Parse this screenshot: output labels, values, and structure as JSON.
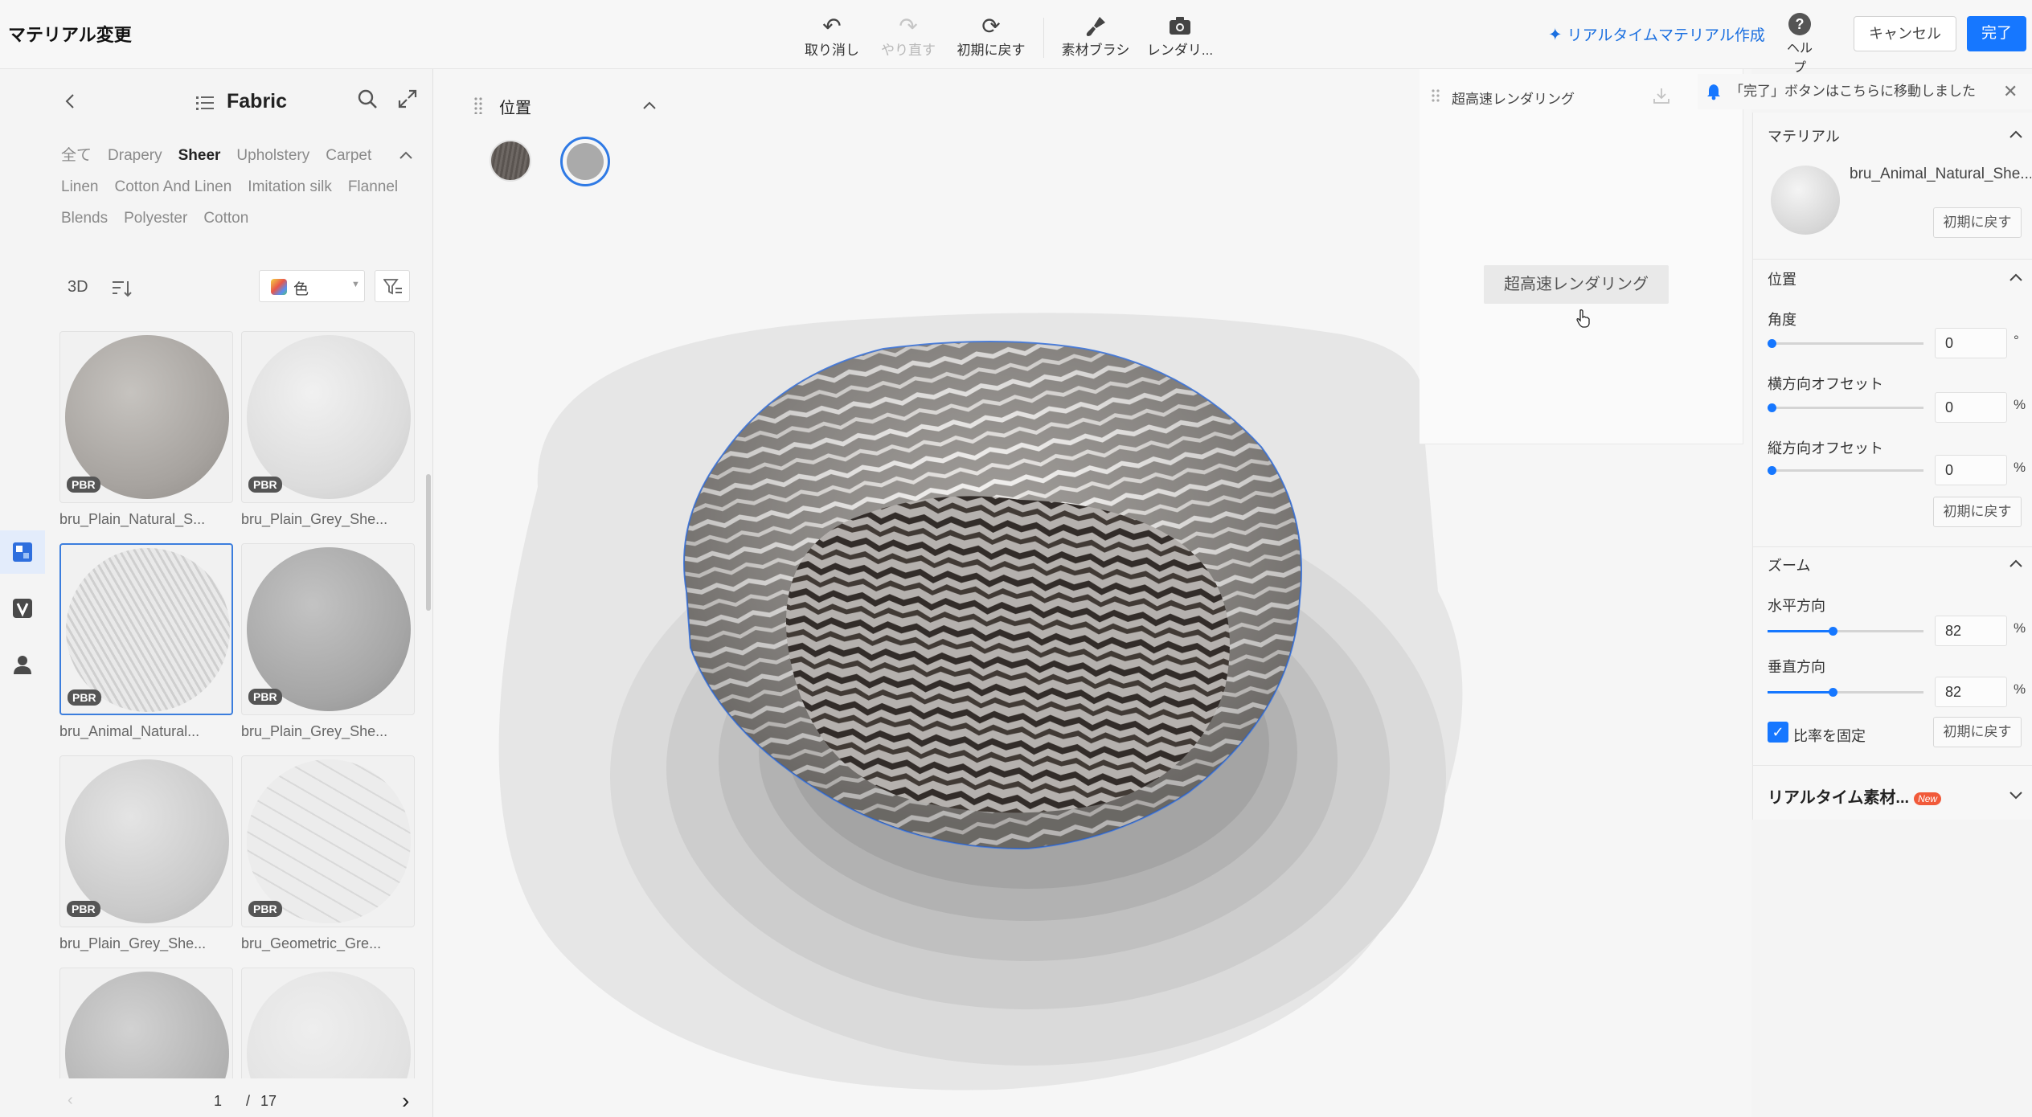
{
  "app": {
    "title": "マテリアル変更"
  },
  "toolbar": {
    "undo": "取り消し",
    "redo": "やり直す",
    "reset": "初期に戻す",
    "brush": "素材ブラシ",
    "render": "レンダリ..."
  },
  "header": {
    "realtime_link": "リアルタイムマテリアル作成",
    "help": "ヘルプ",
    "cancel": "キャンセル",
    "done": "完了",
    "accent": "#1677ff"
  },
  "library": {
    "title": "Fabric",
    "categories": [
      {
        "label": "全て",
        "active": false
      },
      {
        "label": "Drapery",
        "active": false
      },
      {
        "label": "Sheer",
        "active": true
      },
      {
        "label": "Upholstery",
        "active": false
      },
      {
        "label": "Carpet",
        "active": false
      },
      {
        "label": "Linen",
        "active": false
      },
      {
        "label": "Cotton And Linen",
        "active": false
      },
      {
        "label": "Imitation silk",
        "active": false
      },
      {
        "label": "Flannel",
        "active": false
      },
      {
        "label": "Blends",
        "active": false
      },
      {
        "label": "Polyester",
        "active": false
      },
      {
        "label": "Cotton",
        "active": false
      }
    ],
    "view_3d": "3D",
    "color_filter": "色",
    "items": [
      {
        "name": "bru_Plain_Natural_S...",
        "badge": "PBR"
      },
      {
        "name": "bru_Plain_Grey_She...",
        "badge": "PBR"
      },
      {
        "name": "bru_Animal_Natural...",
        "badge": "PBR",
        "selected": true
      },
      {
        "name": "bru_Plain_Grey_She...",
        "badge": "PBR"
      },
      {
        "name": "bru_Plain_Grey_She...",
        "badge": "PBR"
      },
      {
        "name": "bru_Geometric_Gre...",
        "badge": "PBR"
      }
    ],
    "pager": {
      "current": "1",
      "separator": "/",
      "total": "17"
    }
  },
  "viewport": {
    "position_panel_title": "位置",
    "render_panel_title": "超高速レンダリング",
    "render_button": "超高速レンダリング"
  },
  "notice": {
    "text": "「完了」ボタンはこちらに移動しました"
  },
  "properties": {
    "material": {
      "title": "マテリアル",
      "name": "bru_Animal_Natural_She...",
      "reset": "初期に戻す"
    },
    "position": {
      "title": "位置",
      "angle_label": "角度",
      "angle_value": "0",
      "angle_unit": "°",
      "h_offset_label": "横方向オフセット",
      "h_offset_value": "0",
      "v_offset_label": "縦方向オフセット",
      "v_offset_value": "0",
      "percent": "%",
      "reset": "初期に戻す"
    },
    "zoom": {
      "title": "ズーム",
      "horizontal_label": "水平方向",
      "horizontal_value": "82",
      "vertical_label": "垂直方向",
      "vertical_value": "82",
      "lock_ratio_label": "比率を固定",
      "lock_ratio_checked": true,
      "reset": "初期に戻す"
    },
    "realtime": {
      "title": "リアルタイム素材...",
      "badge": "New"
    }
  }
}
